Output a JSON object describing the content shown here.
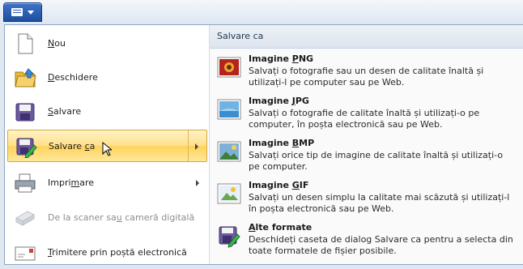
{
  "app_button": {
    "icon": "app-menu-icon"
  },
  "left_menu": {
    "items": [
      {
        "pre": "",
        "u": "N",
        "post": "ou",
        "icon": "new-document-icon",
        "has_submenu": false,
        "state": "normal"
      },
      {
        "pre": "",
        "u": "D",
        "post": "eschidere",
        "icon": "open-folder-icon",
        "has_submenu": false,
        "state": "normal"
      },
      {
        "pre": "",
        "u": "S",
        "post": "alvare",
        "icon": "save-disk-icon",
        "has_submenu": false,
        "state": "normal"
      },
      {
        "pre": "Salvare ",
        "u": "c",
        "post": "a",
        "icon": "save-as-icon",
        "has_submenu": true,
        "state": "active"
      },
      {
        "pre": "Impri",
        "u": "m",
        "post": "are",
        "icon": "printer-icon",
        "has_submenu": true,
        "state": "normal"
      },
      {
        "pre": "De la scaner sa",
        "u": "u",
        "post": " cameră digitală",
        "icon": "scanner-icon",
        "has_submenu": false,
        "state": "disabled"
      },
      {
        "pre": "",
        "u": "T",
        "post": "rimitere prin poștă electronică",
        "icon": "email-icon",
        "has_submenu": false,
        "state": "normal"
      }
    ]
  },
  "submenu": {
    "title": "Salvare ca",
    "items": [
      {
        "title_pre": "Imagine ",
        "title_u": "P",
        "title_post": "NG",
        "icon": "png-image-icon",
        "desc": "Salvați o fotografie sau un desen de calitate înaltă și utilizați-l pe computer sau pe Web."
      },
      {
        "title_pre": "Imagine ",
        "title_u": "J",
        "title_post": "PG",
        "icon": "jpg-image-icon",
        "desc": "Salvați o fotografie de calitate înaltă și utilizați-o pe computer, în poșta electronică sau pe Web."
      },
      {
        "title_pre": "Imagine ",
        "title_u": "B",
        "title_post": "MP",
        "icon": "bmp-image-icon",
        "desc": "Salvați orice tip de imagine de calitate înaltă și utilizați-o pe computer."
      },
      {
        "title_pre": "Imagine ",
        "title_u": "G",
        "title_post": "IF",
        "icon": "gif-image-icon",
        "desc": "Salvați un desen simplu la calitate mai scăzută și utilizați-l în poșta electronică sau pe Web."
      },
      {
        "title_pre": "",
        "title_u": "A",
        "title_post": "lte formate",
        "icon": "other-formats-icon",
        "desc": "Deschideți caseta de dialog Salvare ca pentru a selecta din toate formatele de fișier posibile."
      }
    ]
  },
  "colors": {
    "accent": "#1d4f9e",
    "highlight": "#ffd35a",
    "border": "#8fa6c4"
  }
}
